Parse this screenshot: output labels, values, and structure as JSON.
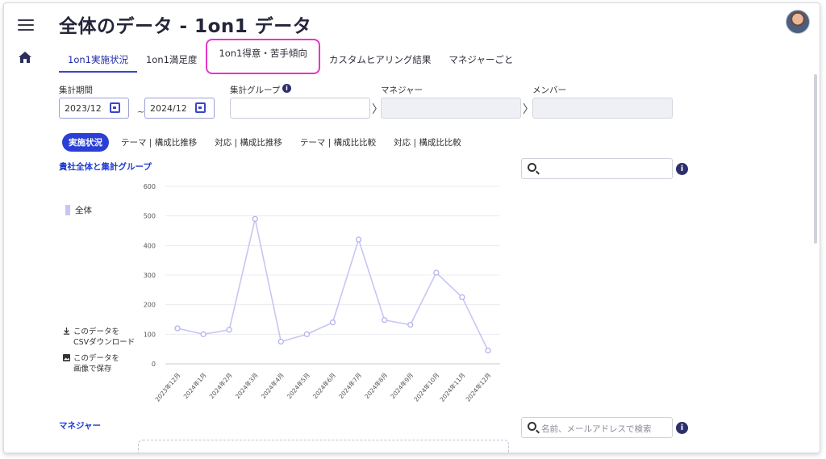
{
  "page": {
    "title": "全体のデータ - 1on1 データ"
  },
  "tabs": [
    {
      "label": "1on1実施状況",
      "active": true
    },
    {
      "label": "1on1満足度"
    },
    {
      "label": "1on1得意・苦手傾向",
      "highlighted": true
    },
    {
      "label": "カスタムヒアリング結果"
    },
    {
      "label": "マネジャーごと"
    }
  ],
  "filters": {
    "period_label": "集計期間",
    "period_from": "2023/12",
    "period_separator": "~",
    "period_to": "2024/12",
    "group_label": "集計グループ",
    "manager_label": "マネジャー",
    "member_label": "メンバー"
  },
  "subtabs": [
    {
      "label": "実施状況",
      "active": true
    },
    {
      "label": "テーマ | 構成比推移"
    },
    {
      "label": "対応 | 構成比推移"
    },
    {
      "label": "テーマ | 構成比比較"
    },
    {
      "label": "対応 | 構成比比較"
    }
  ],
  "section1": {
    "title": "貴社全体と集計グループ"
  },
  "section2": {
    "title": "マネジャー",
    "search_placeholder": "名前、メールアドレスで検索"
  },
  "actions": {
    "csv_line1": "このデータを",
    "csv_line2": "CSVダウンロード",
    "img_line1": "このデータを",
    "img_line2": "画像で保存"
  },
  "colors": {
    "accent": "#2b3fd6",
    "series": "#c6c6f4",
    "highlight_border": "#e535c8"
  },
  "chart_data": {
    "type": "line",
    "categories": [
      "2023年12月",
      "2024年1月",
      "2024年2月",
      "2024年3月",
      "2024年4月",
      "2024年5月",
      "2024年6月",
      "2024年7月",
      "2024年8月",
      "2024年9月",
      "2024年10月",
      "2024年11月",
      "2024年12月"
    ],
    "series": [
      {
        "name": "全体",
        "values": [
          120,
          100,
          115,
          490,
          75,
          100,
          140,
          420,
          148,
          132,
          308,
          225,
          45
        ]
      }
    ],
    "ylim": [
      0,
      600
    ],
    "yticks": [
      0,
      100,
      200,
      300,
      400,
      500,
      600
    ],
    "grid": true,
    "legend_position": "left"
  }
}
